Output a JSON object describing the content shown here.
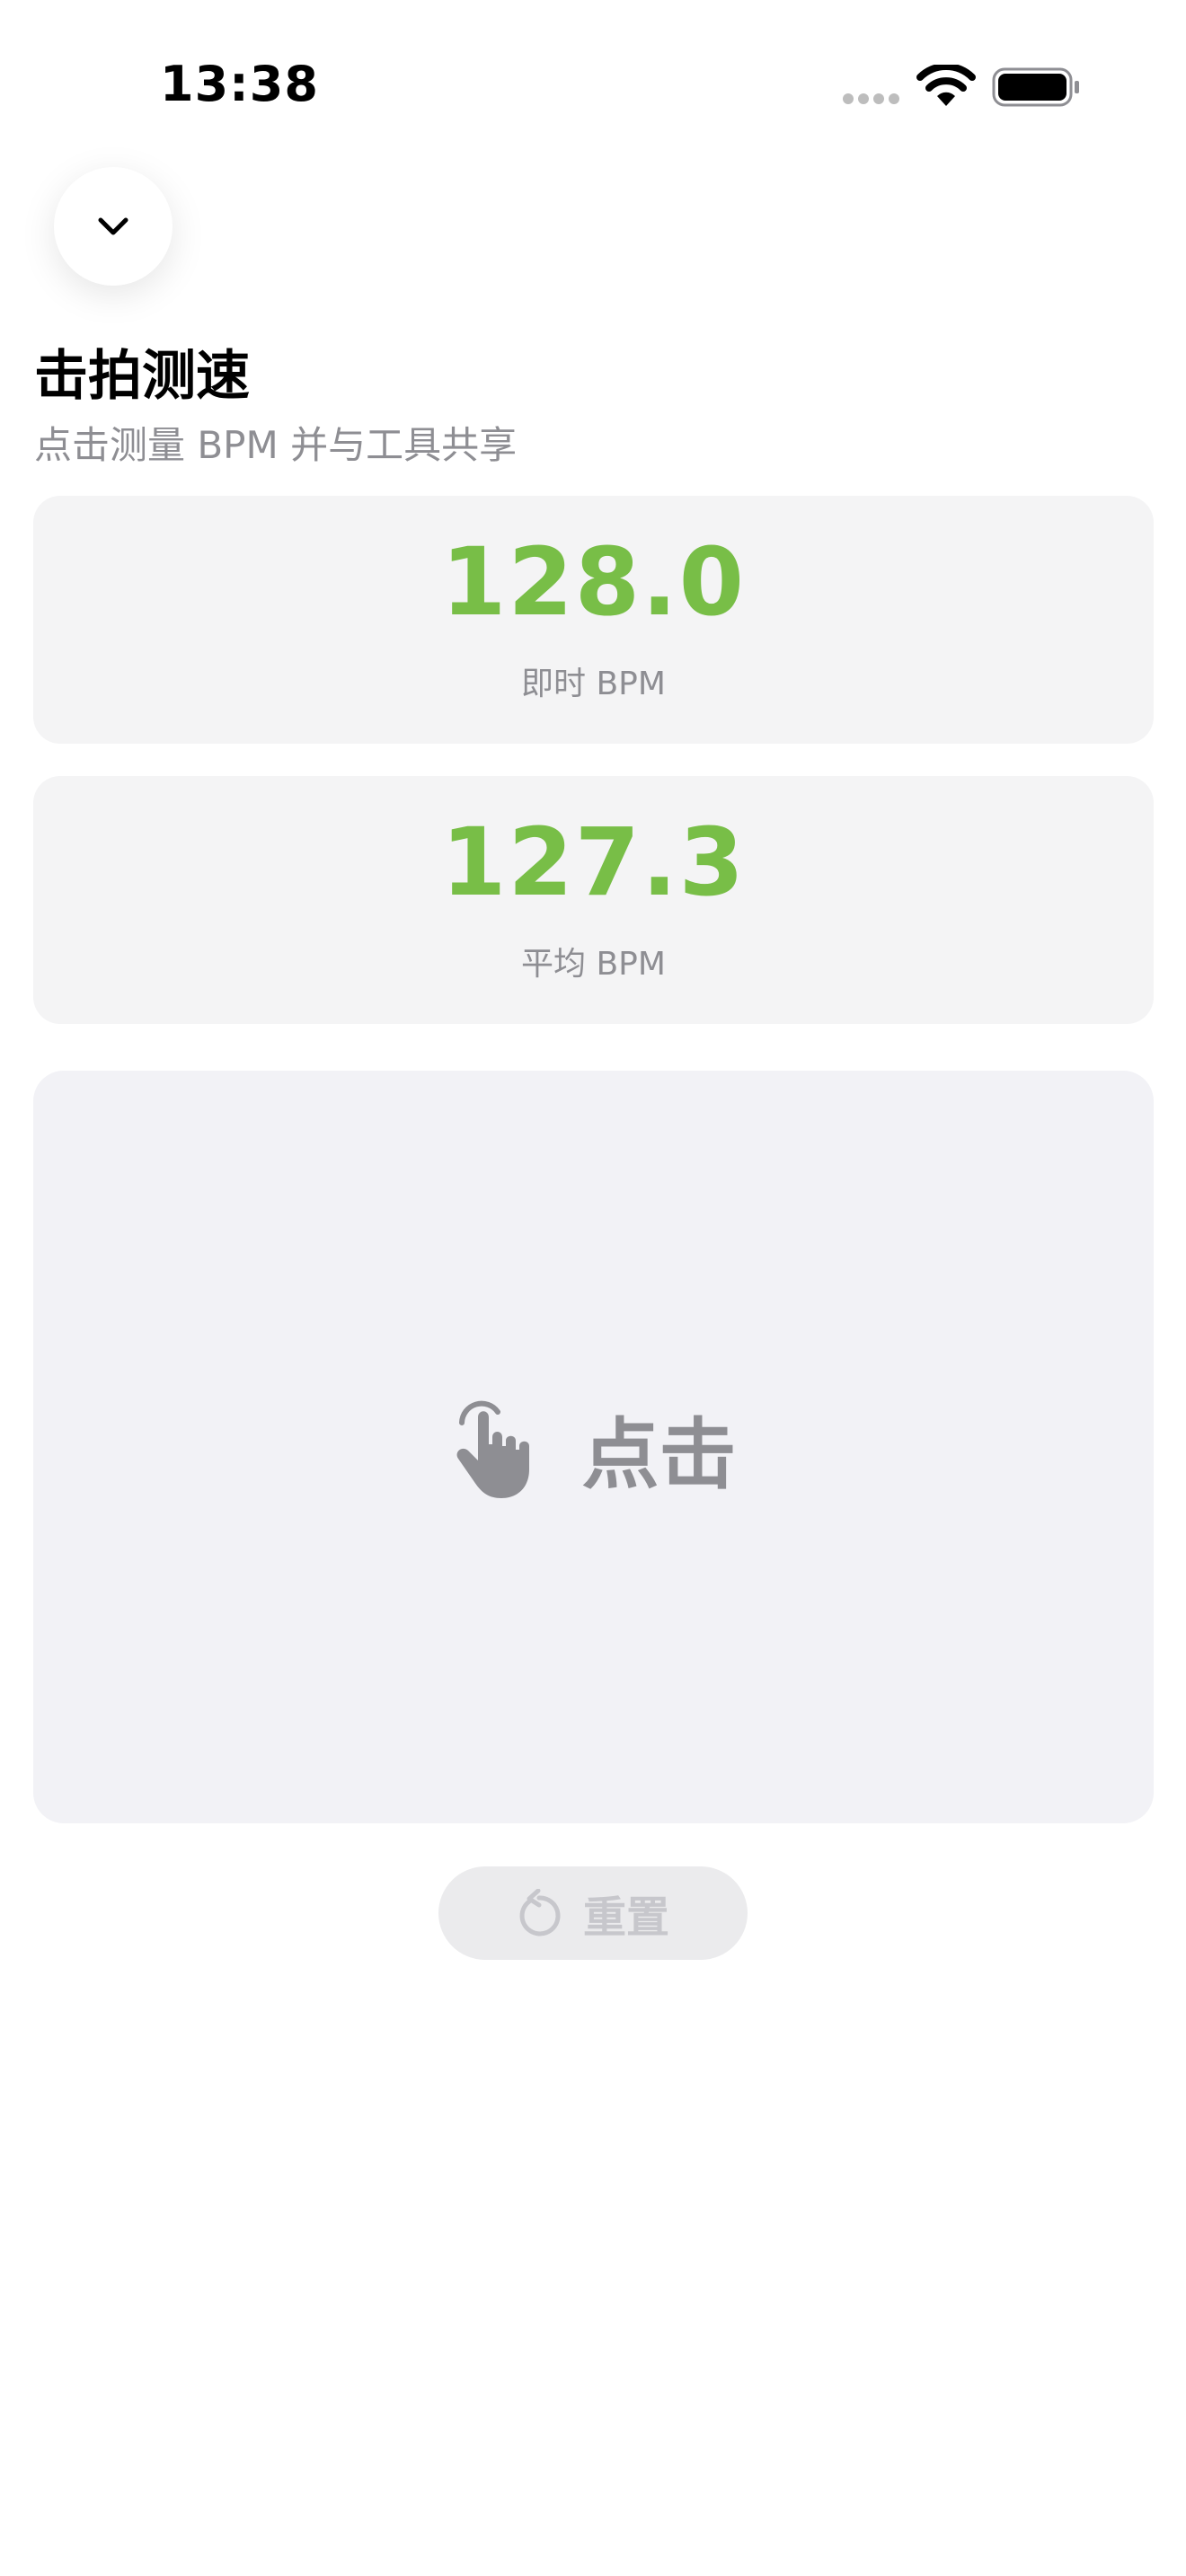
{
  "status_bar": {
    "time": "13:38",
    "wifi_icon": "wifi-icon",
    "battery_icon": "battery-icon"
  },
  "header": {
    "collapse_icon": "chevron-down-icon",
    "title": "击拍测速",
    "subtitle": "点击测量 BPM 并与工具共享"
  },
  "instant": {
    "value": "128.0",
    "label": "即时 BPM"
  },
  "average": {
    "value": "127.3",
    "label": "平均 BPM"
  },
  "tap": {
    "icon": "hand-tap-icon",
    "label": "点击"
  },
  "reset": {
    "icon": "reset-arrow-icon",
    "label": "重置"
  },
  "colors": {
    "accent_green": "#78be47",
    "secondary_text": "#8e8e93",
    "card_bg": "#f4f4f5",
    "tap_bg": "#f2f2f6",
    "disabled": "#c7c7cc"
  }
}
